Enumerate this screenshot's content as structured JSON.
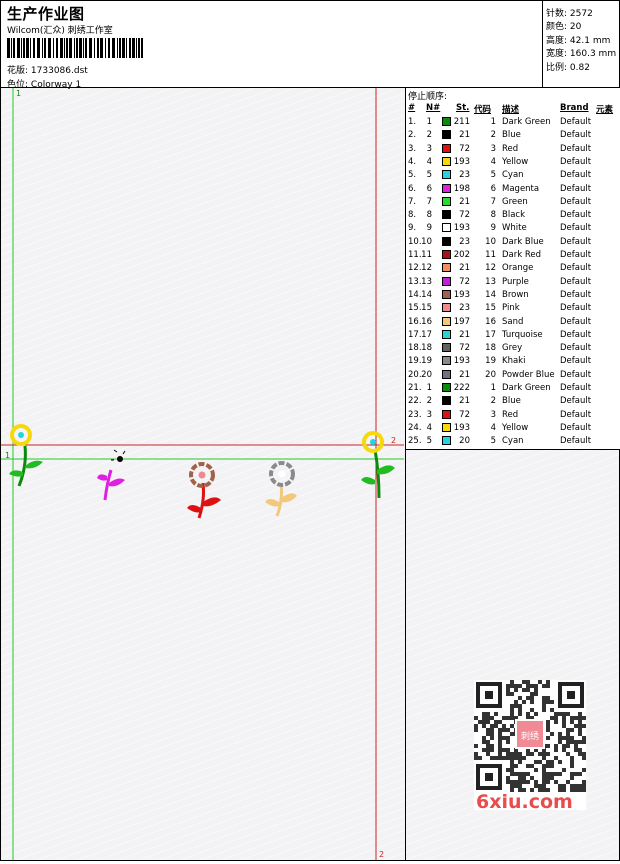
{
  "header": {
    "title": "生产作业图",
    "company": "Wilcom(汇众) 刺绣工作室",
    "design_label": "花版:",
    "design_value": "1733086.dst",
    "colorway_label": "色位:",
    "colorway_value": "Colorway 1"
  },
  "stats": {
    "stitches_label": "针数:",
    "stitches_value": "2572",
    "colors_label": "颜色:",
    "colors_value": "20",
    "height_label": "高度:",
    "height_value": "42.1 mm",
    "width_label": "宽度:",
    "width_value": "160.3 mm",
    "scale_label": "比例:",
    "scale_value": "0.82"
  },
  "preview": {
    "marker_1_top": "1",
    "marker_1_left": "1",
    "marker_2_right": "2",
    "marker_2_bottom": "2"
  },
  "stop_sequence": {
    "title": "停止顺序:",
    "columns": [
      "#",
      "N#",
      "St.",
      "代码",
      "描述",
      "Brand",
      "元素"
    ],
    "rows": [
      {
        "idx": "1.",
        "n": "1",
        "color": "#0a8a0a",
        "st": "211",
        "code": "1",
        "desc": "Dark Green",
        "brand": "Default"
      },
      {
        "idx": "2.",
        "n": "2",
        "color": "#000000",
        "st": "21",
        "code": "2",
        "desc": "Blue",
        "brand": "Default"
      },
      {
        "idx": "3.",
        "n": "3",
        "color": "#dd1111",
        "st": "72",
        "code": "3",
        "desc": "Red",
        "brand": "Default"
      },
      {
        "idx": "4.",
        "n": "4",
        "color": "#f5d90a",
        "st": "193",
        "code": "4",
        "desc": "Yellow",
        "brand": "Default"
      },
      {
        "idx": "5.",
        "n": "5",
        "color": "#22d4e0",
        "st": "23",
        "code": "5",
        "desc": "Cyan",
        "brand": "Default"
      },
      {
        "idx": "6.",
        "n": "6",
        "color": "#e020e0",
        "st": "198",
        "code": "6",
        "desc": "Magenta",
        "brand": "Default"
      },
      {
        "idx": "7.",
        "n": "7",
        "color": "#2adb2a",
        "st": "21",
        "code": "7",
        "desc": "Green",
        "brand": "Default"
      },
      {
        "idx": "8.",
        "n": "8",
        "color": "#000000",
        "st": "72",
        "code": "8",
        "desc": "Black",
        "brand": "Default"
      },
      {
        "idx": "9.",
        "n": "9",
        "color": "#ffffff",
        "st": "193",
        "code": "9",
        "desc": "White",
        "brand": "Default"
      },
      {
        "idx": "10.",
        "n": "10",
        "color": "#000000",
        "st": "23",
        "code": "10",
        "desc": "Dark Blue",
        "brand": "Default"
      },
      {
        "idx": "11.",
        "n": "11",
        "color": "#b01010",
        "st": "202",
        "code": "11",
        "desc": "Dark Red",
        "brand": "Default"
      },
      {
        "idx": "12.",
        "n": "12",
        "color": "#f09060",
        "st": "21",
        "code": "12",
        "desc": "Orange",
        "brand": "Default"
      },
      {
        "idx": "13.",
        "n": "13",
        "color": "#c020d8",
        "st": "72",
        "code": "13",
        "desc": "Purple",
        "brand": "Default"
      },
      {
        "idx": "14.",
        "n": "14",
        "color": "#a0624a",
        "st": "193",
        "code": "14",
        "desc": "Brown",
        "brand": "Default"
      },
      {
        "idx": "15.",
        "n": "15",
        "color": "#f08890",
        "st": "23",
        "code": "15",
        "desc": "Pink",
        "brand": "Default"
      },
      {
        "idx": "16.",
        "n": "16",
        "color": "#f2c87a",
        "st": "197",
        "code": "16",
        "desc": "Sand",
        "brand": "Default"
      },
      {
        "idx": "17.",
        "n": "17",
        "color": "#22d8d0",
        "st": "21",
        "code": "17",
        "desc": "Turquoise",
        "brand": "Default"
      },
      {
        "idx": "18.",
        "n": "18",
        "color": "#606060",
        "st": "72",
        "code": "18",
        "desc": "Grey",
        "brand": "Default"
      },
      {
        "idx": "19.",
        "n": "19",
        "color": "#8a8a8a",
        "st": "193",
        "code": "19",
        "desc": "Khaki",
        "brand": "Default"
      },
      {
        "idx": "20.",
        "n": "20",
        "color": "#707080",
        "st": "21",
        "code": "20",
        "desc": "Powder Blue",
        "brand": "Default"
      },
      {
        "idx": "21.",
        "n": "1",
        "color": "#0a8a0a",
        "st": "222",
        "code": "1",
        "desc": "Dark Green",
        "brand": "Default"
      },
      {
        "idx": "22.",
        "n": "2",
        "color": "#000000",
        "st": "21",
        "code": "2",
        "desc": "Blue",
        "brand": "Default"
      },
      {
        "idx": "23.",
        "n": "3",
        "color": "#dd1111",
        "st": "72",
        "code": "3",
        "desc": "Red",
        "brand": "Default"
      },
      {
        "idx": "24.",
        "n": "4",
        "color": "#f5d90a",
        "st": "193",
        "code": "4",
        "desc": "Yellow",
        "brand": "Default"
      },
      {
        "idx": "25.",
        "n": "5",
        "color": "#22d4e0",
        "st": "20",
        "code": "5",
        "desc": "Cyan",
        "brand": "Default"
      }
    ]
  },
  "watermark": {
    "logo_text": "6xiu.com",
    "qr_badge": "刺绣"
  }
}
